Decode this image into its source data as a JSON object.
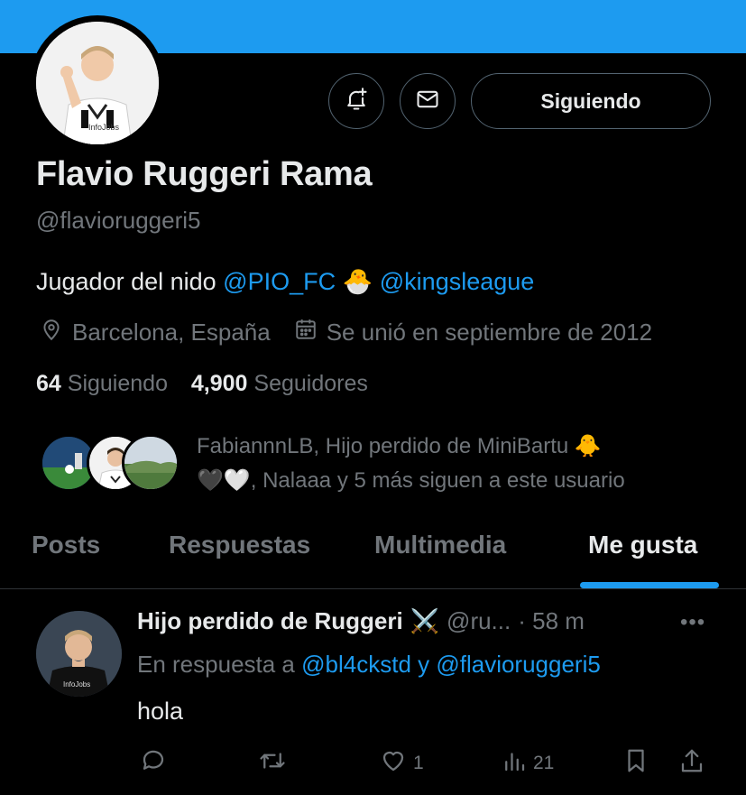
{
  "profile": {
    "name": "Flavio Ruggeri Rama",
    "handle": "@flavioruggeri5",
    "bio_text": "Jugador del nido",
    "bio_link1": "@PIO_FC",
    "bio_emoji": "🐣",
    "bio_link2": "@kingsleague",
    "location": "Barcelona, España",
    "joined": "Se unió en septiembre de 2012",
    "following_count": "64",
    "following_label": "Siguiendo",
    "followers_count": "4,900",
    "followers_label": "Seguidores",
    "follow_button": "Siguiendo",
    "known_followers_line1": "FabiannnLB, Hijo perdido de MiniBartu 🐥",
    "known_followers_line2": "🖤🤍, Nalaaa y 5 más siguen a este usuario"
  },
  "tabs": [
    "Posts",
    "Respuestas",
    "Multimedia",
    "Me gusta"
  ],
  "active_tab": "Me gusta",
  "post": {
    "author": "Hijo perdido de Ruggeri",
    "author_emoji": "⚔️",
    "handle": "@ru...",
    "time": "· 58 m",
    "more": "•••",
    "reply_prefix": "En respuesta a",
    "reply_to": "@bl4ckstd y @flavioruggeri5",
    "text": "hola",
    "likes": "1",
    "views": "21"
  },
  "colors": {
    "accent": "#1d9bf0",
    "background": "#000000",
    "text": "#e7e9ea",
    "muted": "#71767b",
    "border": "#2f3336"
  },
  "icons": [
    "bell-plus-icon",
    "mail-icon",
    "location-pin-icon",
    "calendar-icon",
    "reply-icon",
    "repost-icon",
    "heart-icon",
    "views-icon",
    "bookmark-icon",
    "share-icon"
  ]
}
